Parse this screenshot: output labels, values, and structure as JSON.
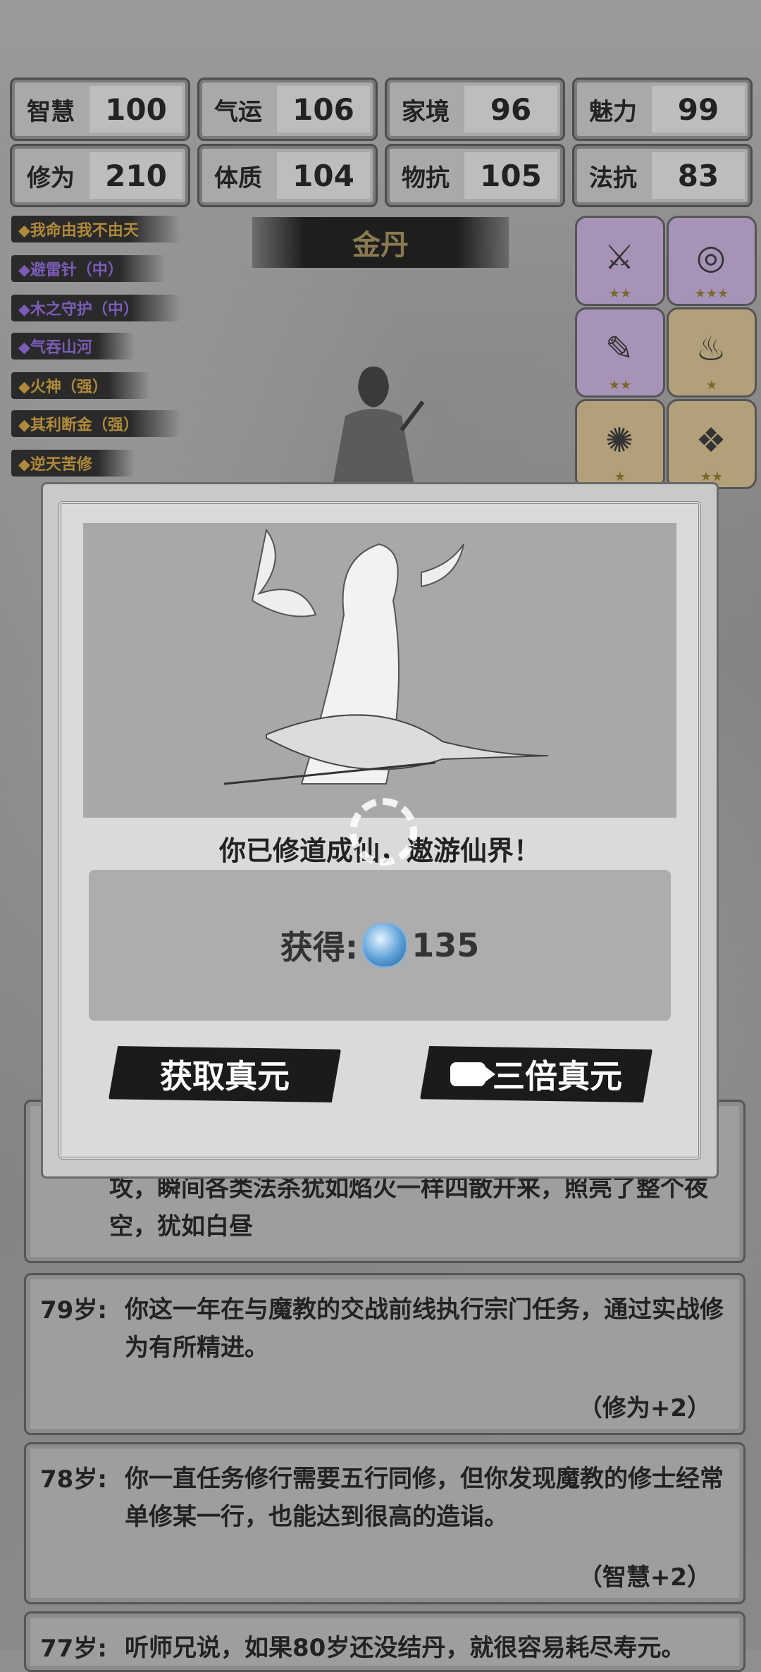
{
  "stats": [
    {
      "name": "智慧",
      "value": "100"
    },
    {
      "name": "气运",
      "value": "106"
    },
    {
      "name": "家境",
      "value": "96"
    },
    {
      "name": "魅力",
      "value": "99"
    },
    {
      "name": "修为",
      "value": "210"
    },
    {
      "name": "体质",
      "value": "104"
    },
    {
      "name": "物抗",
      "value": "105"
    },
    {
      "name": "法抗",
      "value": "83"
    }
  ],
  "buffs": [
    {
      "label": "◆我命由我不由天",
      "color": "gold"
    },
    {
      "label": "◆避雷针（中）",
      "color": "purple"
    },
    {
      "label": "◆木之守护（中）",
      "color": "purple"
    },
    {
      "label": "◆气吞山河",
      "color": "purple"
    },
    {
      "label": "◆火神（强）",
      "color": "gold"
    },
    {
      "label": "◆其利断金（强）",
      "color": "gold"
    },
    {
      "label": "◆逆天苦修",
      "color": "gold"
    }
  ],
  "realm": "金丹",
  "items": [
    {
      "icon": "sword-icon",
      "glyph": "⚔",
      "rarity": "purple",
      "stars": "★★"
    },
    {
      "icon": "jade-disc-icon",
      "glyph": "◎",
      "rarity": "purple",
      "stars": "★★★"
    },
    {
      "icon": "scroll-icon",
      "glyph": "✎",
      "rarity": "purple",
      "stars": "★★"
    },
    {
      "icon": "teapot-icon",
      "glyph": "♨",
      "rarity": "gold",
      "stars": "★"
    },
    {
      "icon": "orb-icon",
      "glyph": "✺",
      "rarity": "gold",
      "stars": "★"
    },
    {
      "icon": "fan-icon",
      "glyph": "❖",
      "rarity": "gold",
      "stars": "★★"
    }
  ],
  "logs": [
    {
      "age": "",
      "text": "攻，瞬间各类法杀犹如焰火一样四散开来，照亮了整个夜空，犹如白昼",
      "effect": ""
    },
    {
      "age": "79岁:",
      "text": "你这一年在与魔教的交战前线执行宗门任务，通过实战修为有所精进。",
      "effect": "（修为+2）"
    },
    {
      "age": "78岁:",
      "text": "你一直任务修行需要五行同修，但你发现魔教的修士经常单修某一行，也能达到很高的造诣。",
      "effect": "（智慧+2）"
    },
    {
      "age": "77岁:",
      "text": "听师兄说，如果80岁还没结丹，就很容易耗尽寿元。",
      "effect": ""
    }
  ],
  "modal": {
    "message": "你已修道成仙，遨游仙界！",
    "reward_label": "获得:",
    "reward_value": "135",
    "btn_claim": "获取真元",
    "btn_triple": "三倍真元"
  }
}
